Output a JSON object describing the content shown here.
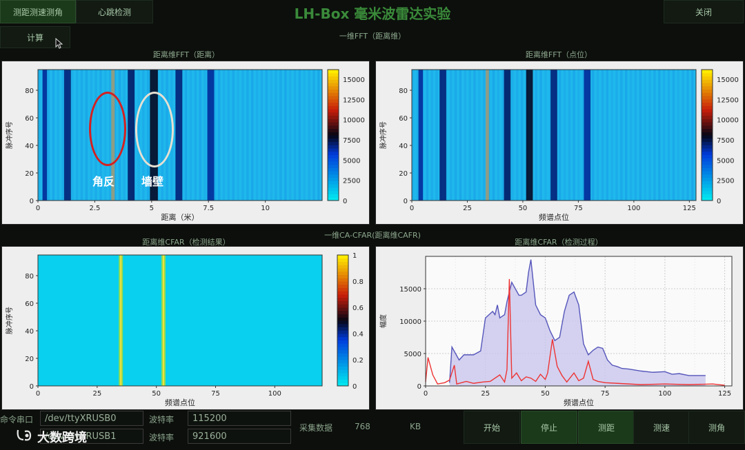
{
  "toolbar": {
    "tab1": "测距测速测角",
    "tab2": "心跳检测",
    "calc": "计算",
    "close": "关闭"
  },
  "app_title": "LH-Box 毫米波雷达实验",
  "sections": {
    "fft_title": "一维FFT（距离维）",
    "cfar_title": "一维CA-CFAR(距离维CAFR)"
  },
  "panels": {
    "p1_title": "距离维FFT（距离）",
    "p2_title": "距离维FFT（点位）",
    "p3_title": "距离维CFAR（检测结果）",
    "p4_title": "距离维CFAR（检测过程）"
  },
  "annotations": {
    "corner_reflector": "角反",
    "wall": "墙壁"
  },
  "bottom": {
    "cmd_port_label": "命令串口",
    "cmd_port_value": "/dev/ttyXRUSB0",
    "data_port_value": "/dev/ttyXRUSB1",
    "baud_label": "波特率",
    "baud1": "115200",
    "baud2": "921600",
    "collect_label": "采集数据",
    "collect_value": "768",
    "collect_unit": "KB",
    "buttons": [
      "开始",
      "停止",
      "测距",
      "测速",
      "测角"
    ]
  },
  "watermark": "大数跨境",
  "chart_data": [
    {
      "type": "heatmap",
      "title": "距离维FFT（距离）",
      "xlabel": "距离（米）",
      "ylabel": "脉冲序号",
      "xlim": [
        0,
        12.5
      ],
      "ylim": [
        0,
        95
      ],
      "xticks": [
        "0",
        "2.5",
        "5",
        "7.5",
        "10"
      ],
      "yticks": [
        "0",
        "20",
        "40",
        "60",
        "80"
      ],
      "colorbar": [
        0,
        2500,
        5000,
        7500,
        10000,
        12500,
        15000
      ],
      "bands": [
        {
          "x": 0.3,
          "w": 0.2,
          "v": 0.2
        },
        {
          "x": 1.3,
          "w": 0.3,
          "v": 0.3
        },
        {
          "x": 3.3,
          "w": 0.15,
          "v": 1.0
        },
        {
          "x": 4.1,
          "w": 0.3,
          "v": 0.35
        },
        {
          "x": 5.1,
          "w": 0.35,
          "v": 0.55
        },
        {
          "x": 6.2,
          "w": 0.3,
          "v": 0.3
        },
        {
          "x": 7.6,
          "w": 0.3,
          "v": 0.2
        }
      ]
    },
    {
      "type": "heatmap",
      "title": "距离维FFT（点位）",
      "xlabel": "频谱点位",
      "ylabel": "脉冲序号",
      "xlim": [
        0,
        128
      ],
      "ylim": [
        0,
        95
      ],
      "xticks": [
        "0",
        "25",
        "50",
        "75",
        "100",
        "125"
      ],
      "yticks": [
        "0",
        "20",
        "40",
        "60",
        "80"
      ],
      "colorbar": [
        0,
        2500,
        5000,
        7500,
        10000,
        12500,
        15000
      ],
      "bands": [
        {
          "x": 4,
          "w": 2,
          "v": 0.2
        },
        {
          "x": 14,
          "w": 3,
          "v": 0.3
        },
        {
          "x": 34,
          "w": 1.5,
          "v": 1.0
        },
        {
          "x": 43,
          "w": 3,
          "v": 0.35
        },
        {
          "x": 53,
          "w": 3,
          "v": 0.55
        },
        {
          "x": 64,
          "w": 3,
          "v": 0.3
        },
        {
          "x": 79,
          "w": 3,
          "v": 0.2
        }
      ]
    },
    {
      "type": "heatmap",
      "title": "距离维CFAR（检测结果）",
      "xlabel": "频谱点位",
      "ylabel": "脉冲序号",
      "xlim": [
        0,
        120
      ],
      "ylim": [
        0,
        95
      ],
      "xticks": [
        "0",
        "25",
        "50",
        "75",
        "100"
      ],
      "yticks": [
        "0",
        "20",
        "40",
        "60",
        "80"
      ],
      "colorbar": [
        0,
        0.2,
        0.4,
        0.6,
        0.8,
        1
      ],
      "detections": [
        35,
        53
      ]
    },
    {
      "type": "line",
      "title": "距离维CFAR（检测过程）",
      "xlabel": "频谱点位",
      "ylabel": "幅度",
      "xlim": [
        0,
        128
      ],
      "ylim": [
        0,
        20000
      ],
      "xticks": [
        "0",
        "25",
        "50",
        "75",
        "100",
        "125"
      ],
      "yticks": [
        "0",
        "5000",
        "10000",
        "15000"
      ],
      "series": [
        {
          "name": "",
          "color": "#5555bb",
          "fill": "#c9c7ec",
          "points": [
            [
              10,
              500
            ],
            [
              11,
              6000
            ],
            [
              14,
              4000
            ],
            [
              16,
              4800
            ],
            [
              20,
              4800
            ],
            [
              23,
              5400
            ],
            [
              25,
              10500
            ],
            [
              28,
              11500
            ],
            [
              29,
              11000
            ],
            [
              30,
              12500
            ],
            [
              31,
              10500
            ],
            [
              33,
              11000
            ],
            [
              34,
              13000
            ],
            [
              36,
              16000
            ],
            [
              39,
              14000
            ],
            [
              40,
              14000
            ],
            [
              42,
              14500
            ],
            [
              43,
              17500
            ],
            [
              44,
              19500
            ],
            [
              46,
              12500
            ],
            [
              48,
              11000
            ],
            [
              50,
              10500
            ],
            [
              52,
              8500
            ],
            [
              54,
              7000
            ],
            [
              56,
              7500
            ],
            [
              58,
              11500
            ],
            [
              60,
              14000
            ],
            [
              62,
              14500
            ],
            [
              64,
              12500
            ],
            [
              66,
              6500
            ],
            [
              68,
              4800
            ],
            [
              70,
              5500
            ],
            [
              72,
              6000
            ],
            [
              74,
              5800
            ],
            [
              76,
              4000
            ],
            [
              78,
              3200
            ],
            [
              80,
              3000
            ],
            [
              82,
              2700
            ],
            [
              85,
              2600
            ],
            [
              90,
              2300
            ],
            [
              95,
              2100
            ],
            [
              100,
              2200
            ],
            [
              103,
              1800
            ],
            [
              106,
              1900
            ],
            [
              110,
              1600
            ],
            [
              115,
              1600
            ],
            [
              117,
              1600
            ]
          ]
        },
        {
          "name": "",
          "color": "#ee3333",
          "points": [
            [
              0,
              600
            ],
            [
              1,
              4400
            ],
            [
              3,
              1700
            ],
            [
              5,
              300
            ],
            [
              8,
              500
            ],
            [
              10,
              900
            ],
            [
              12,
              3200
            ],
            [
              13,
              300
            ],
            [
              17,
              700
            ],
            [
              20,
              400
            ],
            [
              24,
              600
            ],
            [
              27,
              700
            ],
            [
              31,
              1700
            ],
            [
              33,
              600
            ],
            [
              34,
              2500
            ],
            [
              35,
              16500
            ],
            [
              36,
              1200
            ],
            [
              38,
              2000
            ],
            [
              40,
              800
            ],
            [
              42,
              1400
            ],
            [
              44,
              1200
            ],
            [
              46,
              700
            ],
            [
              48,
              1800
            ],
            [
              50,
              1000
            ],
            [
              51,
              2000
            ],
            [
              53,
              7200
            ],
            [
              55,
              3000
            ],
            [
              57,
              1600
            ],
            [
              59,
              600
            ],
            [
              62,
              2000
            ],
            [
              64,
              800
            ],
            [
              66,
              1200
            ],
            [
              68,
              3800
            ],
            [
              70,
              1000
            ],
            [
              72,
              700
            ],
            [
              75,
              500
            ],
            [
              80,
              400
            ],
            [
              90,
              200
            ],
            [
              100,
              300
            ],
            [
              110,
              200
            ],
            [
              120,
              300
            ],
            [
              125,
              100
            ]
          ]
        }
      ]
    }
  ]
}
